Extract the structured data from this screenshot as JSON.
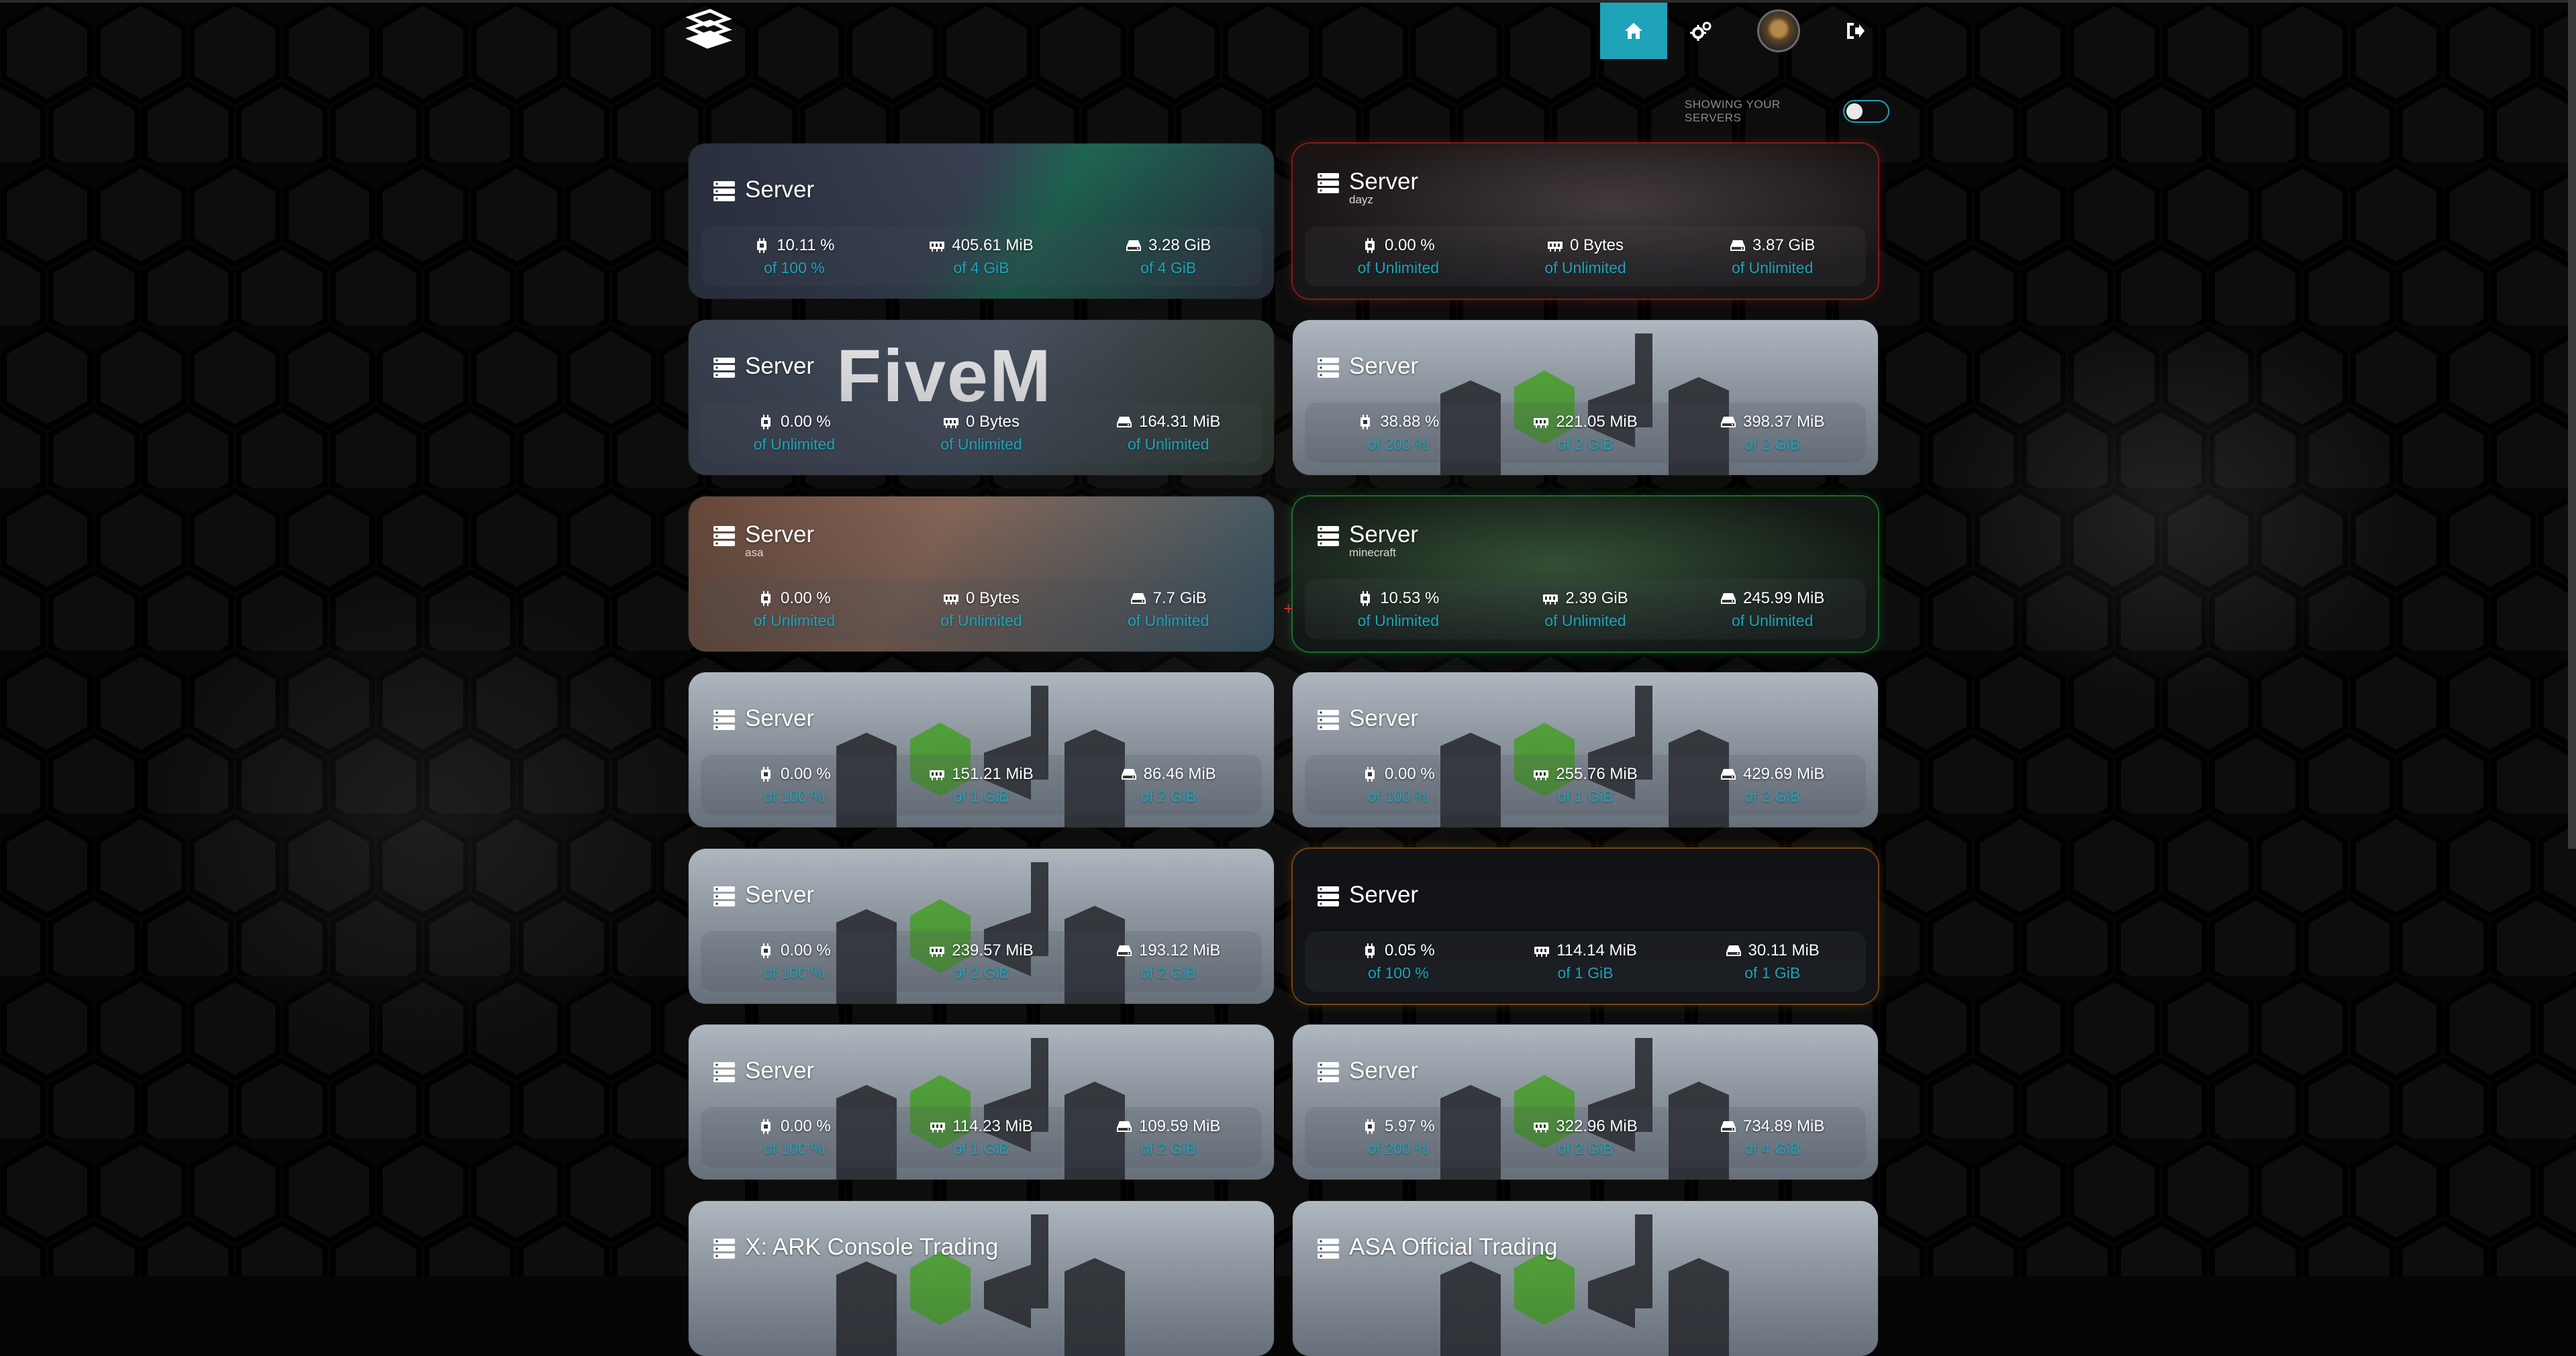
{
  "navbar": {
    "items": [
      {
        "icon": "home-icon",
        "active": true
      },
      {
        "icon": "gears-icon",
        "active": false
      },
      {
        "icon": "avatar",
        "active": false
      },
      {
        "icon": "logout-icon",
        "active": false
      }
    ],
    "accent": "#1ea3b8"
  },
  "toggle": {
    "label": "SHOWING YOUR SERVERS",
    "on": false
  },
  "servers": [
    {
      "name": "Server",
      "sub": "",
      "cpu": "10.11 %",
      "cpu_limit": "of 100 %",
      "mem": "405.61 MiB",
      "mem_limit": "of 4 GiB",
      "disk": "3.28 GiB",
      "disk_limit": "of 4 GiB"
    },
    {
      "name": "Server",
      "sub": "dayz",
      "cpu": "0.00 %",
      "cpu_limit": "of Unlimited",
      "mem": "0 Bytes",
      "mem_limit": "of Unlimited",
      "disk": "3.87 GiB",
      "disk_limit": "of Unlimited"
    },
    {
      "name": "Server",
      "sub": "",
      "cpu": "0.00 %",
      "cpu_limit": "of Unlimited",
      "mem": "0 Bytes",
      "mem_limit": "of Unlimited",
      "disk": "164.31 MiB",
      "disk_limit": "of Unlimited",
      "banner": "FiveM"
    },
    {
      "name": "Server",
      "sub": "",
      "cpu": "38.88 %",
      "cpu_limit": "of 200 %",
      "mem": "221.05 MiB",
      "mem_limit": "of 2 GiB",
      "disk": "398.37 MiB",
      "disk_limit": "of 2 GiB"
    },
    {
      "name": "Server",
      "sub": "asa",
      "cpu": "0.00 %",
      "cpu_limit": "of Unlimited",
      "mem": "0 Bytes",
      "mem_limit": "of Unlimited",
      "disk": "7.7 GiB",
      "disk_limit": "of Unlimited"
    },
    {
      "name": "Server",
      "sub": "minecraft",
      "cpu": "10.53 %",
      "cpu_limit": "of Unlimited",
      "mem": "2.39 GiB",
      "mem_limit": "of Unlimited",
      "disk": "245.99 MiB",
      "disk_limit": "of Unlimited"
    },
    {
      "name": "Server",
      "sub": "",
      "cpu": "0.00 %",
      "cpu_limit": "of 100 %",
      "mem": "151.21 MiB",
      "mem_limit": "of 1 GiB",
      "disk": "86.46 MiB",
      "disk_limit": "of 2 GiB"
    },
    {
      "name": "Server",
      "sub": "",
      "cpu": "0.00 %",
      "cpu_limit": "of 100 %",
      "mem": "255.76 MiB",
      "mem_limit": "of 1 GiB",
      "disk": "429.69 MiB",
      "disk_limit": "of 2 GiB"
    },
    {
      "name": "Server",
      "sub": "",
      "cpu": "0.00 %",
      "cpu_limit": "of 100 %",
      "mem": "239.57 MiB",
      "mem_limit": "of 2 GiB",
      "disk": "193.12 MiB",
      "disk_limit": "of 2 GiB"
    },
    {
      "name": "Server",
      "sub": "",
      "cpu": "0.05 %",
      "cpu_limit": "of 100 %",
      "mem": "114.14 MiB",
      "mem_limit": "of 1 GiB",
      "disk": "30.11 MiB",
      "disk_limit": "of 1 GiB"
    },
    {
      "name": "Server",
      "sub": "",
      "cpu": "0.00 %",
      "cpu_limit": "of 100 %",
      "mem": "114.23 MiB",
      "mem_limit": "of 1 GiB",
      "disk": "109.59 MiB",
      "disk_limit": "of 2 GiB"
    },
    {
      "name": "Server",
      "sub": "",
      "cpu": "5.97 %",
      "cpu_limit": "of 200 %",
      "mem": "322.96 MiB",
      "mem_limit": "of 2 GiB",
      "disk": "734.89 MiB",
      "disk_limit": "of 4 GiB"
    },
    {
      "name": "X: ARK Console Trading",
      "sub": ""
    },
    {
      "name": "ASA Official Trading",
      "sub": ""
    }
  ]
}
